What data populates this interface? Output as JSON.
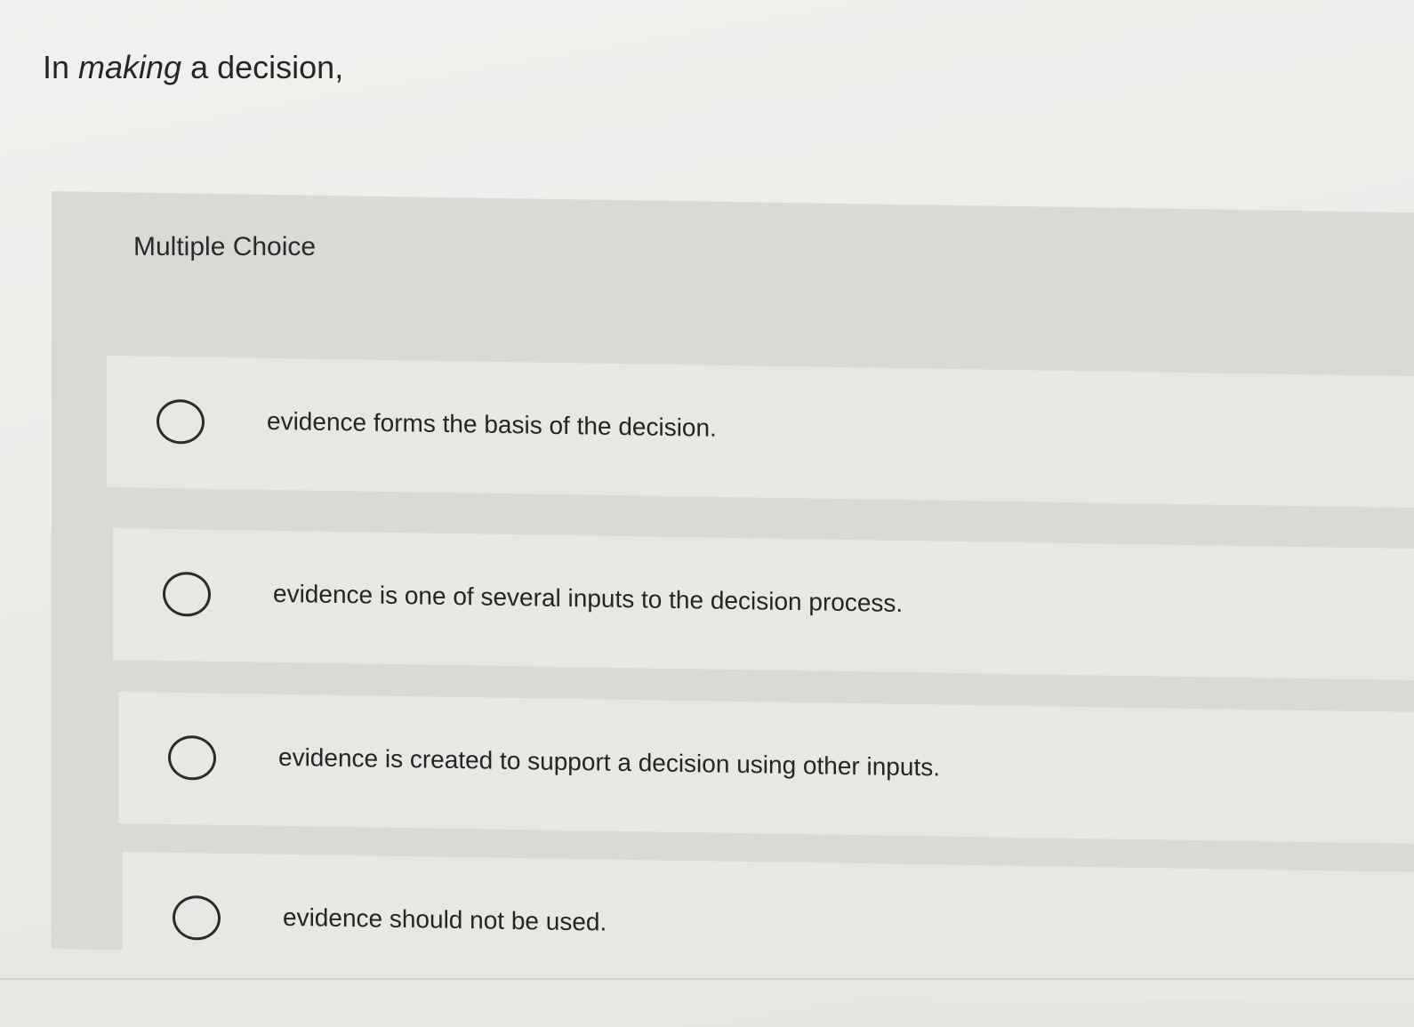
{
  "question": {
    "prefix": "In ",
    "emphasis": "making",
    "suffix": " a decision,"
  },
  "section_label": "Multiple Choice",
  "choices": [
    {
      "label": "evidence forms the basis of the decision."
    },
    {
      "label": "evidence is one of several inputs to the decision process."
    },
    {
      "label": "evidence is created to support a decision using other inputs."
    },
    {
      "label": "evidence should not be used."
    }
  ],
  "colors": {
    "background": "#ededeb",
    "panel": "#d9dad6",
    "choice_row": "#e7e8e4",
    "text": "#262626",
    "radio_border": "#2b2b2b"
  }
}
